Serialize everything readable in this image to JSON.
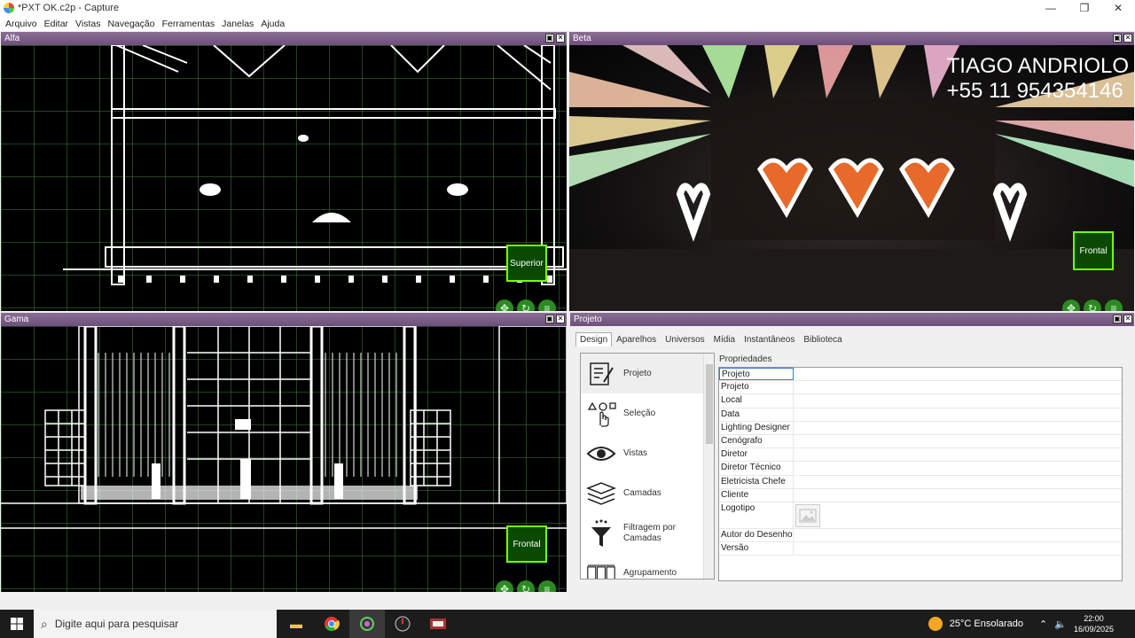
{
  "window": {
    "title": "*PXT OK.c2p - Capture",
    "minimize": "—",
    "maximize": "❐",
    "close": "✕"
  },
  "menu": [
    "Arquivo",
    "Editar",
    "Vistas",
    "Navegação",
    "Ferramentas",
    "Janelas",
    "Ajuda"
  ],
  "panels": {
    "alfa": {
      "title": "Alfa",
      "view_label": "Superior"
    },
    "beta": {
      "title": "Beta",
      "view_label": "Frontal",
      "overlay_line1": "TIAGO ANDRIOLO",
      "overlay_line2": "+55 11 954354146"
    },
    "gama": {
      "title": "Gama",
      "view_label": "Frontal"
    },
    "projeto": {
      "title": "Projeto"
    }
  },
  "tabs": [
    "Design",
    "Aparelhos",
    "Universos",
    "Mídia",
    "Instantâneos",
    "Biblioteca"
  ],
  "tools": [
    "Projeto",
    "Seleção",
    "Vistas",
    "Camadas",
    "Filtragem por Camadas",
    "Agrupamento"
  ],
  "properties": {
    "title": "Propriedades",
    "rows": [
      "Projeto",
      "Projeto",
      "Local",
      "Data",
      "Lighting Designer",
      "Cenógrafo",
      "Diretor",
      "Diretor Técnico",
      "Eletricista Chefe",
      "Cliente",
      "Logotipo",
      "Autor do Desenho",
      "Versão"
    ]
  },
  "taskbar": {
    "search_placeholder": "Digite aqui para pesquisar",
    "weather": "25°C  Ensolarado",
    "time": "22:00",
    "date": "16/09/2025"
  },
  "colors": {
    "panel_header": "#6e4f7c",
    "view_label_border": "#77ff00"
  }
}
